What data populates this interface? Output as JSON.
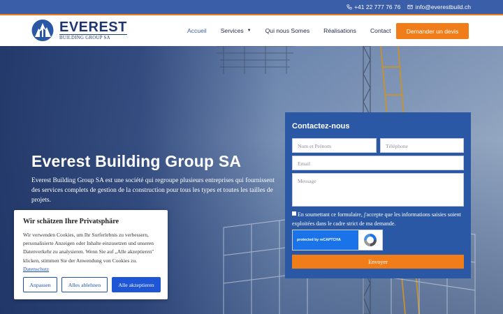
{
  "topbar": {
    "phone": "+41 22 777 76 76",
    "email": "info@everestbuild.ch",
    "phone_icon": "phone-icon",
    "email_icon": "envelope-icon"
  },
  "header": {
    "logo_name": "EVEREST",
    "logo_sub": "BUILDING GROUP SA",
    "nav": [
      {
        "label": "Accueil",
        "active": true
      },
      {
        "label": "Services",
        "has_dropdown": true
      },
      {
        "label": "Qui nous Somes"
      },
      {
        "label": "Réalisations"
      },
      {
        "label": "Contact"
      }
    ],
    "cta_label": "Demander un devis"
  },
  "hero": {
    "title": "Everest Building Group SA",
    "text": "Everest Building Group SA est une société qui regroupe plusieurs entreprises qui fournissent des services complets de gestion de la construction pour tous les types et toutes les tailles de projets."
  },
  "contact_form": {
    "title": "Contactez-nous",
    "name_placeholder": "Nom et Prénom",
    "phone_placeholder": "Téléphone",
    "email_placeholder": "Email",
    "message_placeholder": "Message",
    "consent_text": "En soumettant ce formulaire, j'accepte que les informations saisies soient exploitées dans le cadre strict de ma demande.",
    "captcha_label": "protected by reCAPTCHA",
    "submit_label": "Envoyer"
  },
  "cookie_banner": {
    "title": "Wir schätzen Ihre Privatsphäre",
    "text": "Wir verwenden Cookies, um Ihr Surferlebnis zu verbessern, personalisierte Anzeigen oder Inhalte einzusetzen und unseren Datenverkehr zu analysieren. Wenn Sie auf „Alle akzeptieren\" klicken, stimmen Sie der Anwendung von Cookies zu.",
    "link_label": "Datenschutz",
    "btn_customize": "Anpassen",
    "btn_reject": "Alles ablehnen",
    "btn_accept": "Alle akzeptieren"
  },
  "colors": {
    "brand_blue": "#3a5ea8",
    "accent_orange": "#f07d1a",
    "logo_navy": "#1e3772"
  }
}
